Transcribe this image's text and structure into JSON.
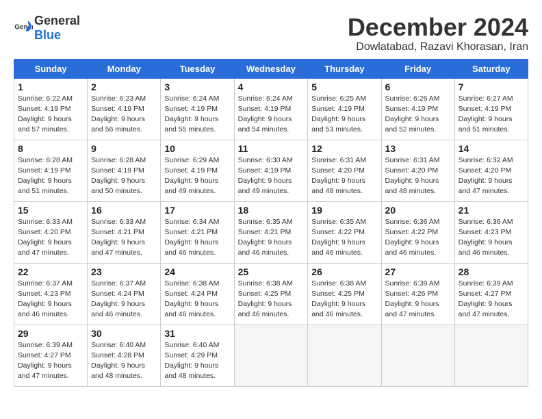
{
  "header": {
    "logo_general": "General",
    "logo_blue": "Blue",
    "month_title": "December 2024",
    "location": "Dowlatabad, Razavi Khorasan, Iran"
  },
  "weekdays": [
    "Sunday",
    "Monday",
    "Tuesday",
    "Wednesday",
    "Thursday",
    "Friday",
    "Saturday"
  ],
  "weeks": [
    [
      {
        "day": "1",
        "info": "Sunrise: 6:22 AM\nSunset: 4:19 PM\nDaylight: 9 hours\nand 57 minutes."
      },
      {
        "day": "2",
        "info": "Sunrise: 6:23 AM\nSunset: 4:19 PM\nDaylight: 9 hours\nand 56 minutes."
      },
      {
        "day": "3",
        "info": "Sunrise: 6:24 AM\nSunset: 4:19 PM\nDaylight: 9 hours\nand 55 minutes."
      },
      {
        "day": "4",
        "info": "Sunrise: 6:24 AM\nSunset: 4:19 PM\nDaylight: 9 hours\nand 54 minutes."
      },
      {
        "day": "5",
        "info": "Sunrise: 6:25 AM\nSunset: 4:19 PM\nDaylight: 9 hours\nand 53 minutes."
      },
      {
        "day": "6",
        "info": "Sunrise: 6:26 AM\nSunset: 4:19 PM\nDaylight: 9 hours\nand 52 minutes."
      },
      {
        "day": "7",
        "info": "Sunrise: 6:27 AM\nSunset: 4:19 PM\nDaylight: 9 hours\nand 51 minutes."
      }
    ],
    [
      {
        "day": "8",
        "info": "Sunrise: 6:28 AM\nSunset: 4:19 PM\nDaylight: 9 hours\nand 51 minutes."
      },
      {
        "day": "9",
        "info": "Sunrise: 6:28 AM\nSunset: 4:19 PM\nDaylight: 9 hours\nand 50 minutes."
      },
      {
        "day": "10",
        "info": "Sunrise: 6:29 AM\nSunset: 4:19 PM\nDaylight: 9 hours\nand 49 minutes."
      },
      {
        "day": "11",
        "info": "Sunrise: 6:30 AM\nSunset: 4:19 PM\nDaylight: 9 hours\nand 49 minutes."
      },
      {
        "day": "12",
        "info": "Sunrise: 6:31 AM\nSunset: 4:20 PM\nDaylight: 9 hours\nand 48 minutes."
      },
      {
        "day": "13",
        "info": "Sunrise: 6:31 AM\nSunset: 4:20 PM\nDaylight: 9 hours\nand 48 minutes."
      },
      {
        "day": "14",
        "info": "Sunrise: 6:32 AM\nSunset: 4:20 PM\nDaylight: 9 hours\nand 47 minutes."
      }
    ],
    [
      {
        "day": "15",
        "info": "Sunrise: 6:33 AM\nSunset: 4:20 PM\nDaylight: 9 hours\nand 47 minutes."
      },
      {
        "day": "16",
        "info": "Sunrise: 6:33 AM\nSunset: 4:21 PM\nDaylight: 9 hours\nand 47 minutes."
      },
      {
        "day": "17",
        "info": "Sunrise: 6:34 AM\nSunset: 4:21 PM\nDaylight: 9 hours\nand 46 minutes."
      },
      {
        "day": "18",
        "info": "Sunrise: 6:35 AM\nSunset: 4:21 PM\nDaylight: 9 hours\nand 46 minutes."
      },
      {
        "day": "19",
        "info": "Sunrise: 6:35 AM\nSunset: 4:22 PM\nDaylight: 9 hours\nand 46 minutes."
      },
      {
        "day": "20",
        "info": "Sunrise: 6:36 AM\nSunset: 4:22 PM\nDaylight: 9 hours\nand 46 minutes."
      },
      {
        "day": "21",
        "info": "Sunrise: 6:36 AM\nSunset: 4:23 PM\nDaylight: 9 hours\nand 46 minutes."
      }
    ],
    [
      {
        "day": "22",
        "info": "Sunrise: 6:37 AM\nSunset: 4:23 PM\nDaylight: 9 hours\nand 46 minutes."
      },
      {
        "day": "23",
        "info": "Sunrise: 6:37 AM\nSunset: 4:24 PM\nDaylight: 9 hours\nand 46 minutes."
      },
      {
        "day": "24",
        "info": "Sunrise: 6:38 AM\nSunset: 4:24 PM\nDaylight: 9 hours\nand 46 minutes."
      },
      {
        "day": "25",
        "info": "Sunrise: 6:38 AM\nSunset: 4:25 PM\nDaylight: 9 hours\nand 46 minutes."
      },
      {
        "day": "26",
        "info": "Sunrise: 6:38 AM\nSunset: 4:25 PM\nDaylight: 9 hours\nand 46 minutes."
      },
      {
        "day": "27",
        "info": "Sunrise: 6:39 AM\nSunset: 4:26 PM\nDaylight: 9 hours\nand 47 minutes."
      },
      {
        "day": "28",
        "info": "Sunrise: 6:39 AM\nSunset: 4:27 PM\nDaylight: 9 hours\nand 47 minutes."
      }
    ],
    [
      {
        "day": "29",
        "info": "Sunrise: 6:39 AM\nSunset: 4:27 PM\nDaylight: 9 hours\nand 47 minutes."
      },
      {
        "day": "30",
        "info": "Sunrise: 6:40 AM\nSunset: 4:28 PM\nDaylight: 9 hours\nand 48 minutes."
      },
      {
        "day": "31",
        "info": "Sunrise: 6:40 AM\nSunset: 4:29 PM\nDaylight: 9 hours\nand 48 minutes."
      },
      null,
      null,
      null,
      null
    ]
  ]
}
